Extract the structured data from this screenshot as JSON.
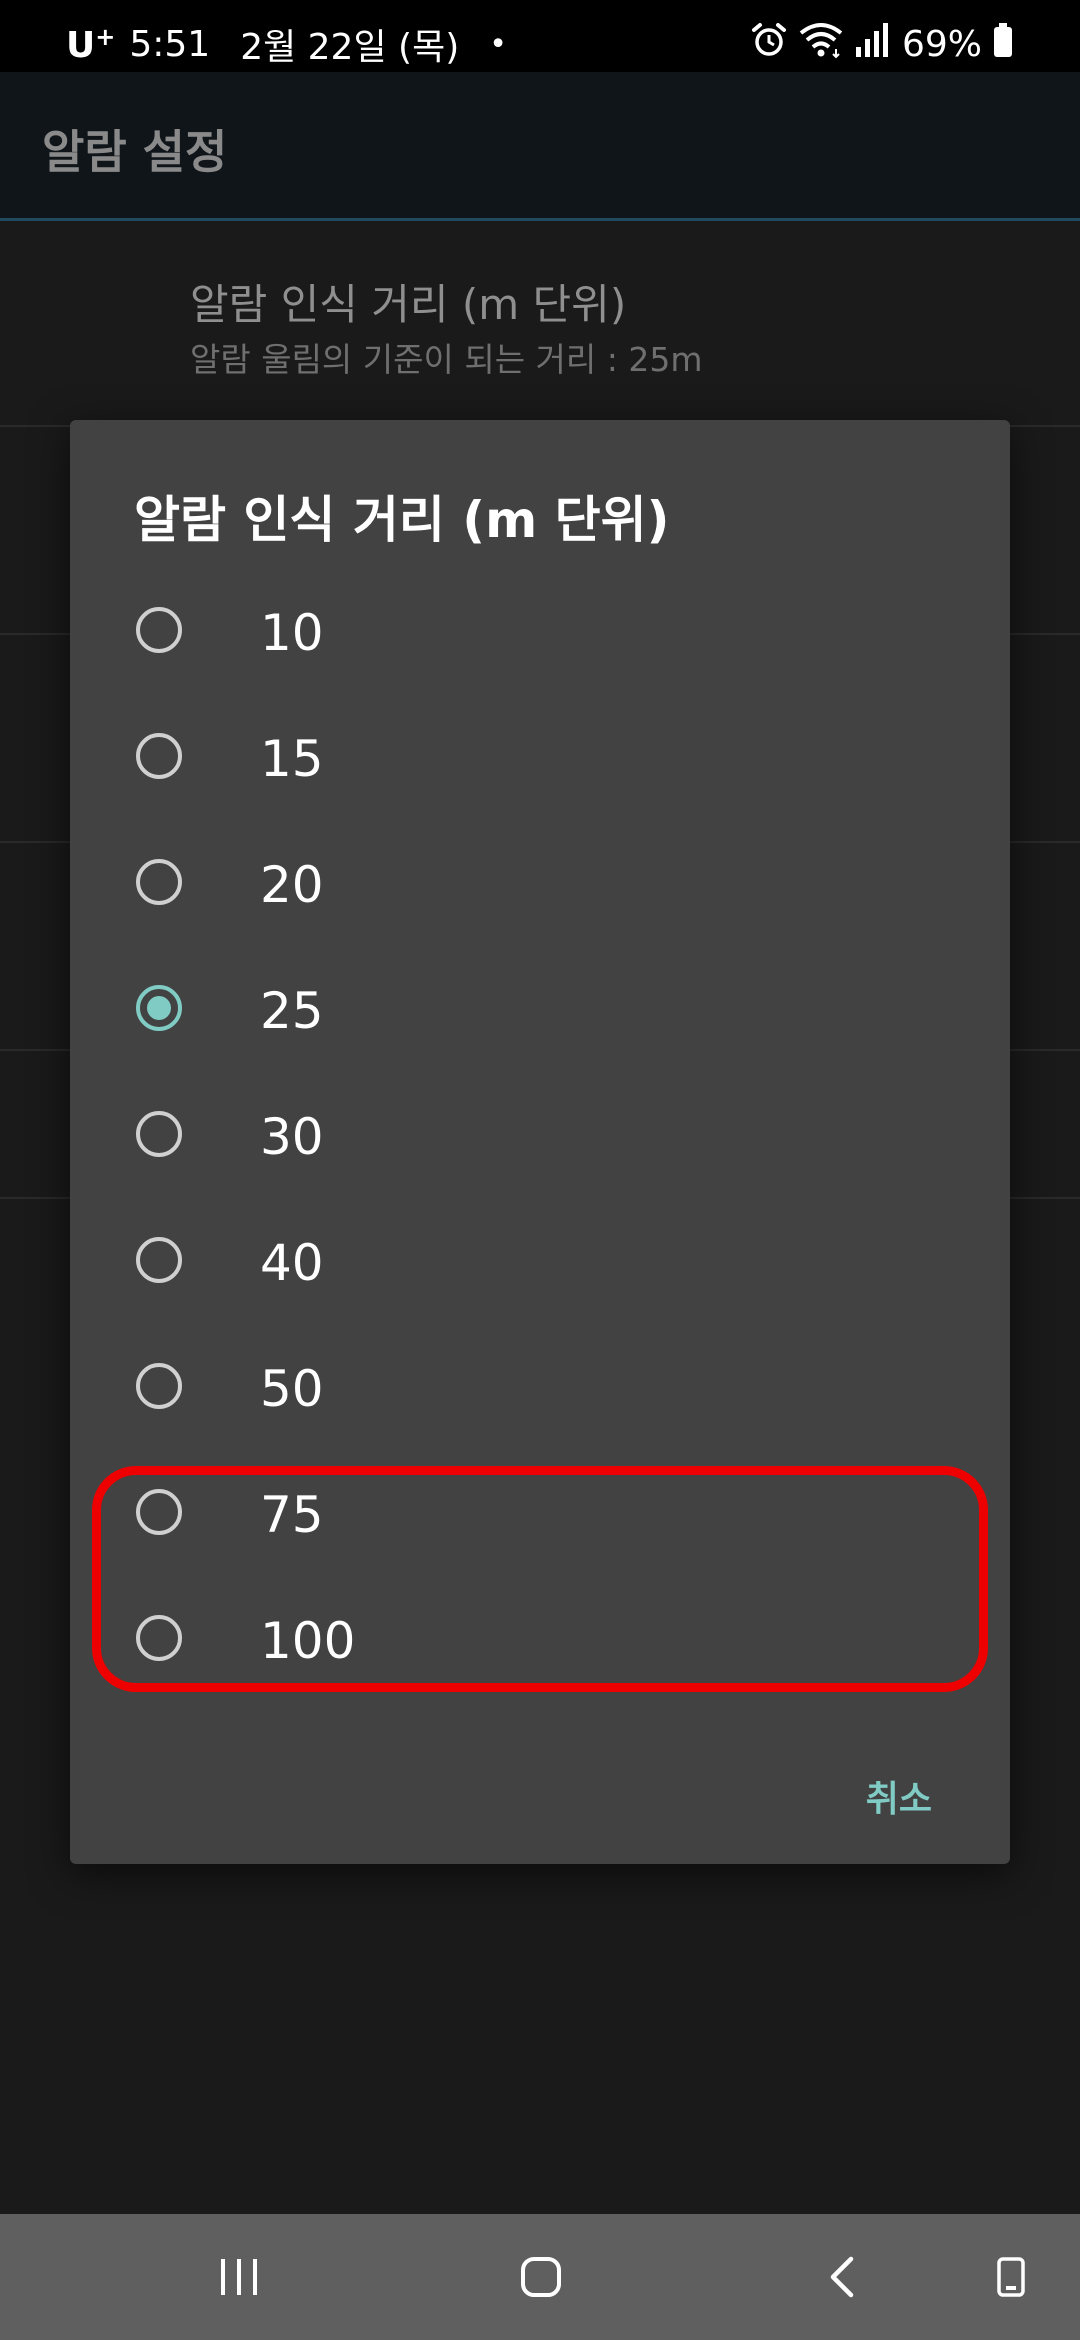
{
  "status_bar": {
    "carrier": "U",
    "carrier_sup": "+",
    "time": "5:51",
    "date": "2월 22일 (목)",
    "dot": "•",
    "battery": "69%",
    "icons": [
      "alarm-icon",
      "wifi-icon",
      "signal-icon",
      "battery-icon"
    ]
  },
  "app_bar": {
    "title": "알람 설정"
  },
  "settings": {
    "items": [
      {
        "title": "알람 인식 거리 (m 단위)",
        "summary": "알람 울림의 기준이 되는 거리 : 25m"
      }
    ]
  },
  "dialog": {
    "title": "알람 인식 거리 (m 단위)",
    "options": [
      {
        "label": "10",
        "checked": false
      },
      {
        "label": "15",
        "checked": false
      },
      {
        "label": "20",
        "checked": false
      },
      {
        "label": "25",
        "checked": true
      },
      {
        "label": "30",
        "checked": false
      },
      {
        "label": "40",
        "checked": false
      },
      {
        "label": "50",
        "checked": false
      },
      {
        "label": "75",
        "checked": false
      },
      {
        "label": "100",
        "checked": false
      }
    ],
    "cancel_label": "취소"
  },
  "nav_bar": {
    "buttons": [
      "recent-apps-icon",
      "home-icon",
      "back-icon",
      "keyboard-icon"
    ]
  },
  "colors": {
    "accent": "#80cbc4",
    "highlight": "#ee0000",
    "dialog_bg": "#424242",
    "screen_bg": "#1a1a1a"
  }
}
